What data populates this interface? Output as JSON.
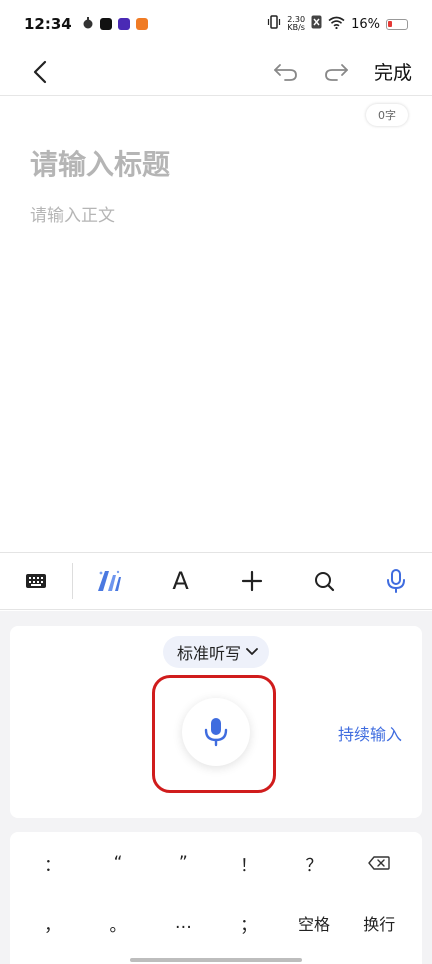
{
  "status": {
    "time": "12:34",
    "net_speed_value": "2.30",
    "net_speed_unit": "KB/s",
    "battery": "16%"
  },
  "toolbar": {
    "done_label": "完成"
  },
  "editor": {
    "word_count": "0字",
    "title_placeholder": "请输入标题",
    "body_placeholder": "请输入正文"
  },
  "format_toolbar": {
    "text_style_label": "A"
  },
  "voice": {
    "mode_label": "标准听写",
    "continuous_label": "持续输入"
  },
  "keyboard": {
    "row1": [
      "：",
      "“",
      "”",
      "！",
      "？"
    ],
    "row2": [
      "，",
      "。",
      "…",
      "；",
      "空格",
      "换行"
    ]
  },
  "colors": {
    "accent": "#3f6cdf",
    "highlight_box": "#d01c1c",
    "placeholder": "#b5b5b5"
  }
}
